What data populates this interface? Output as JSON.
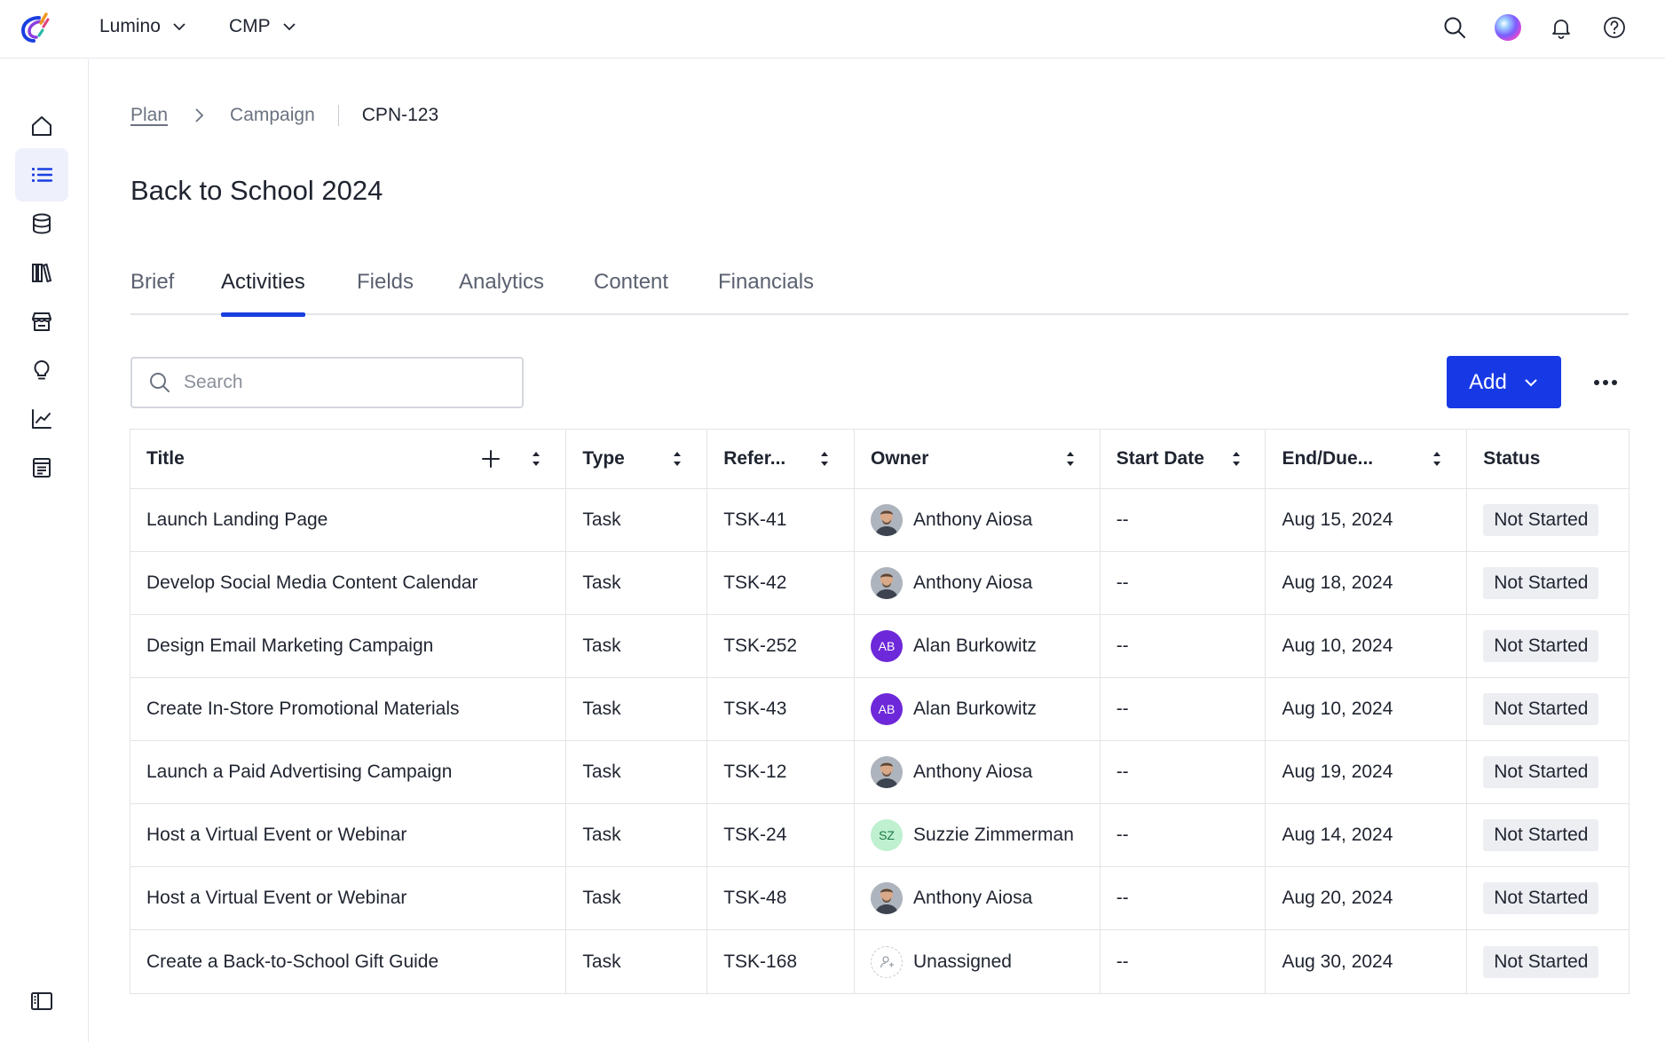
{
  "topbar": {
    "menus": [
      {
        "label": "Lumino"
      },
      {
        "label": "CMP"
      }
    ]
  },
  "breadcrumb": {
    "plan": "Plan",
    "campaign": "Campaign",
    "current": "CPN-123"
  },
  "page": {
    "title": "Back to School 2024"
  },
  "tabs": [
    {
      "label": "Brief"
    },
    {
      "label": "Activities"
    },
    {
      "label": "Fields"
    },
    {
      "label": "Analytics"
    },
    {
      "label": "Content"
    },
    {
      "label": "Financials"
    }
  ],
  "active_tab": "Activities",
  "search": {
    "placeholder": "Search",
    "value": ""
  },
  "toolbar": {
    "add_label": "Add"
  },
  "table": {
    "columns": [
      "Title",
      "Type",
      "Refer...",
      "Owner",
      "Start Date",
      "End/Due...",
      "Status"
    ],
    "rows": [
      {
        "title": "Launch Landing Page",
        "type": "Task",
        "ref": "TSK-41",
        "owner": "Anthony Aiosa",
        "owner_initials": "",
        "start": "--",
        "end": "Aug 15, 2024",
        "status": "Not Started"
      },
      {
        "title": "Develop Social Media Content Calendar",
        "type": "Task",
        "ref": "TSK-42",
        "owner": "Anthony Aiosa",
        "owner_initials": "",
        "start": "--",
        "end": "Aug 18, 2024",
        "status": "Not Started"
      },
      {
        "title": "Design Email Marketing Campaign",
        "type": "Task",
        "ref": "TSK-252",
        "owner": "Alan Burkowitz",
        "owner_initials": "AB",
        "start": "--",
        "end": "Aug 10, 2024",
        "status": "Not Started"
      },
      {
        "title": "Create In-Store Promotional Materials",
        "type": "Task",
        "ref": "TSK-43",
        "owner": "Alan Burkowitz",
        "owner_initials": "AB",
        "start": "--",
        "end": "Aug 10, 2024",
        "status": "Not Started"
      },
      {
        "title": "Launch a Paid Advertising Campaign",
        "type": "Task",
        "ref": "TSK-12",
        "owner": "Anthony Aiosa",
        "owner_initials": "",
        "start": "--",
        "end": "Aug 19, 2024",
        "status": "Not Started"
      },
      {
        "title": "Host a Virtual Event or Webinar",
        "type": "Task",
        "ref": "TSK-24",
        "owner": "Suzzie Zimmerman",
        "owner_initials": "SZ",
        "start": "--",
        "end": "Aug 14, 2024",
        "status": "Not Started"
      },
      {
        "title": "Host a Virtual Event or Webinar",
        "type": "Task",
        "ref": "TSK-48",
        "owner": "Anthony Aiosa",
        "owner_initials": "",
        "start": "--",
        "end": "Aug 20, 2024",
        "status": "Not Started"
      },
      {
        "title": "Create a Back-to-School Gift Guide",
        "type": "Task",
        "ref": "TSK-168",
        "owner": "Unassigned",
        "owner_initials": "",
        "start": "--",
        "end": "Aug 30, 2024",
        "status": "Not Started"
      }
    ]
  },
  "colors": {
    "accent": "#1739e5",
    "tab_underline": "#1a3fe0",
    "avatar_ab": "#6d28d9",
    "avatar_sz": "#bff0d0",
    "status_bg": "#eceef2"
  },
  "icons": {
    "topbar": [
      "search-icon",
      "ai-orb-icon",
      "bell-icon",
      "help-icon"
    ],
    "sidebar": [
      "home-icon",
      "list-icon",
      "database-icon",
      "library-icon",
      "store-icon",
      "lightbulb-icon",
      "chart-icon",
      "document-icon",
      "panel-toggle-icon"
    ]
  }
}
